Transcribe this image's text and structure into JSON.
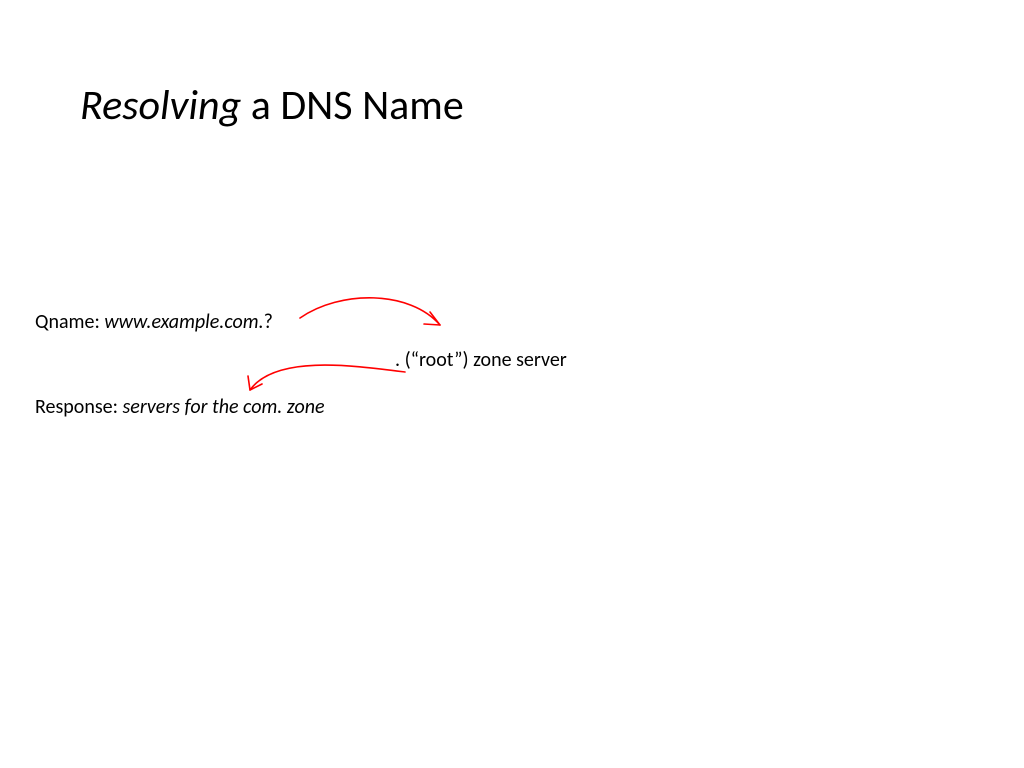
{
  "title": {
    "italic": "Resolving",
    "rest": " a DNS Name"
  },
  "qname": {
    "label": "Qname: ",
    "value": "www.example.com.",
    "suffix": "?"
  },
  "root": {
    "text": ". (“root”) zone server"
  },
  "response": {
    "label": "Response: ",
    "value": "servers for the com. zone"
  },
  "arrow_color": "#ff0000"
}
